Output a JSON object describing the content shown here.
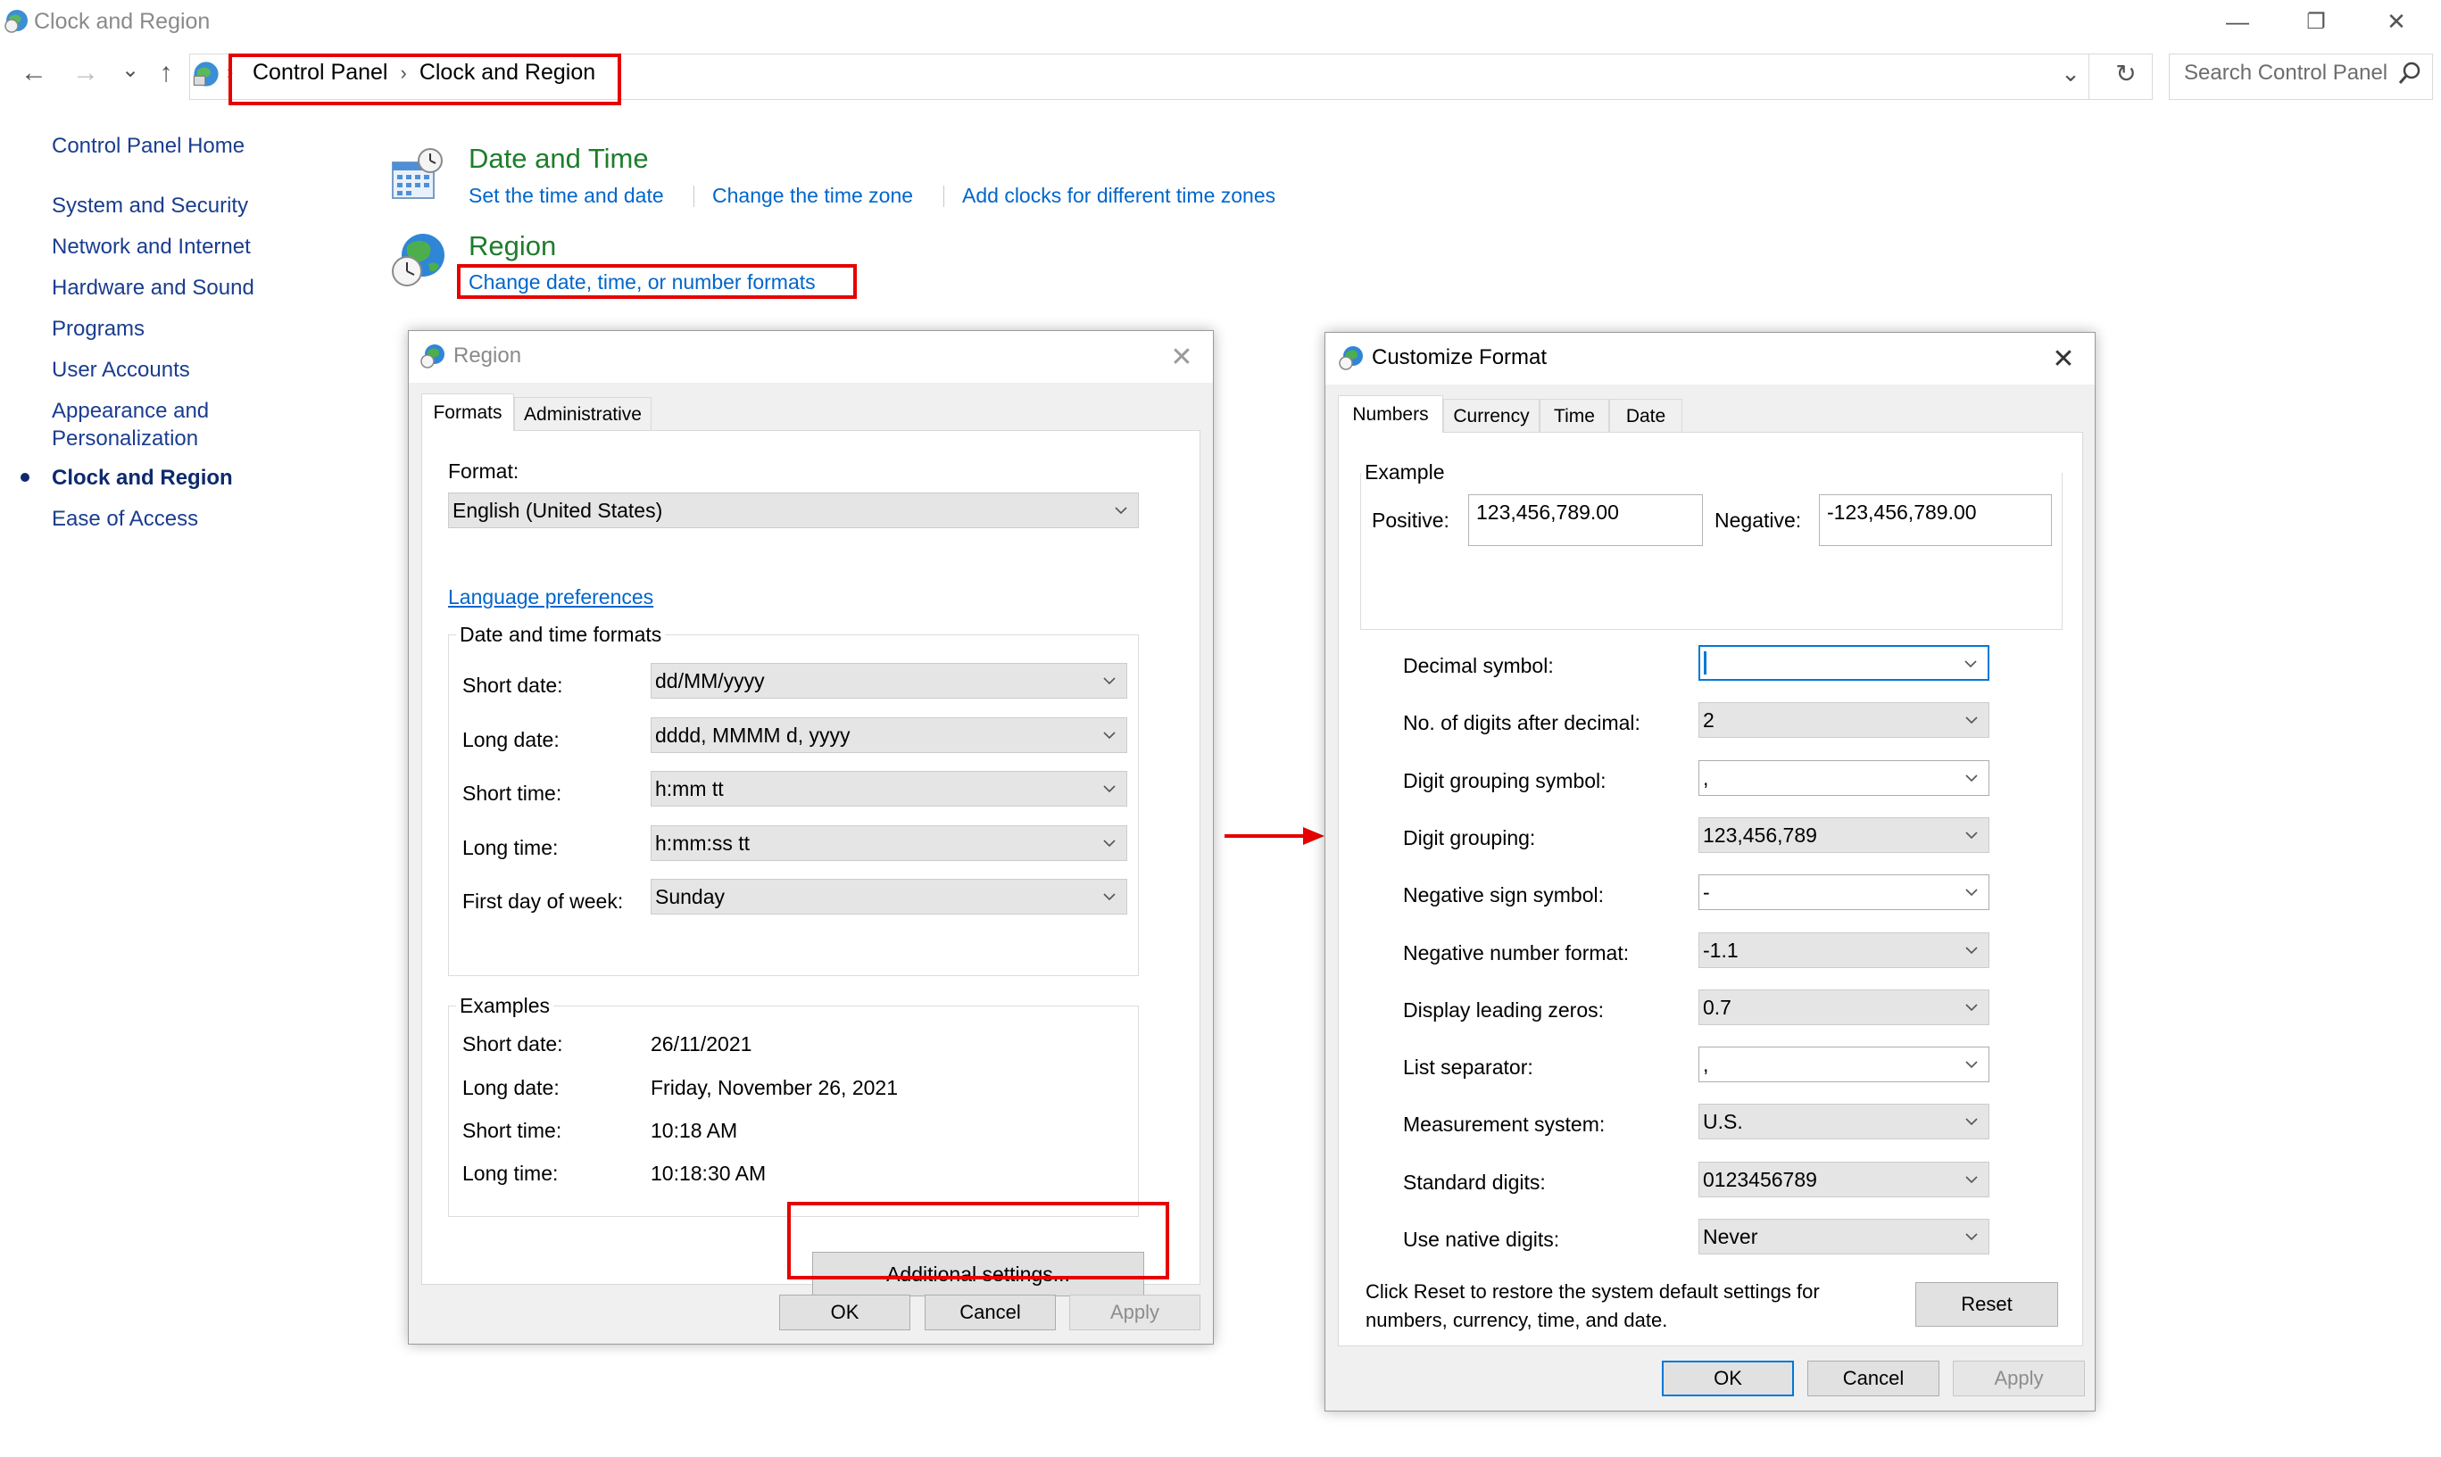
{
  "window": {
    "title": "Clock and Region",
    "minimize_glyph": "—",
    "maximize_glyph": "❐",
    "close_glyph": "✕"
  },
  "address_bar": {
    "back_glyph": "←",
    "forward_glyph": "→",
    "recent_glyph": "⌄",
    "up_glyph": "↑",
    "breadcrumb": [
      "Control Panel",
      "Clock and Region"
    ],
    "separator_glyph": "›",
    "dropdown_glyph": "⌄",
    "refresh_glyph": "↻",
    "search_placeholder": "Search Control Panel"
  },
  "sidebar": {
    "items": [
      {
        "label": "Control Panel Home"
      },
      {
        "label": "System and Security"
      },
      {
        "label": "Network and Internet"
      },
      {
        "label": "Hardware and Sound"
      },
      {
        "label": "Programs"
      },
      {
        "label": "User Accounts"
      },
      {
        "label": "Appearance and\nPersonalization"
      },
      {
        "label": "Clock and Region",
        "active": true
      },
      {
        "label": "Ease of Access"
      }
    ]
  },
  "content": {
    "date_time": {
      "heading": "Date and Time",
      "links": [
        "Set the time and date",
        "Change the time zone",
        "Add clocks for different time zones"
      ]
    },
    "region": {
      "heading": "Region",
      "link": "Change date, time, or number formats"
    }
  },
  "region_dialog": {
    "title": "Region",
    "close_glyph": "✕",
    "tabs": [
      "Formats",
      "Administrative"
    ],
    "format_label": "Format:",
    "format_value": "English (United States)",
    "language_link": "Language preferences",
    "date_time_group": "Date and time formats",
    "fields": [
      {
        "label": "Short date:",
        "value": "dd/MM/yyyy"
      },
      {
        "label": "Long date:",
        "value": "dddd, MMMM d, yyyy"
      },
      {
        "label": "Short time:",
        "value": "h:mm tt"
      },
      {
        "label": "Long time:",
        "value": "h:mm:ss tt"
      },
      {
        "label": "First day of week:",
        "value": "Sunday"
      }
    ],
    "examples_group": "Examples",
    "examples": [
      {
        "label": "Short date:",
        "value": "26/11/2021"
      },
      {
        "label": "Long date:",
        "value": "Friday, November 26, 2021"
      },
      {
        "label": "Short time:",
        "value": "10:18 AM"
      },
      {
        "label": "Long time:",
        "value": "10:18:30 AM"
      }
    ],
    "additional_button": "Additional settings...",
    "ok": "OK",
    "cancel": "Cancel",
    "apply": "Apply"
  },
  "customize_dialog": {
    "title": "Customize Format",
    "close_glyph": "✕",
    "tabs": [
      "Numbers",
      "Currency",
      "Time",
      "Date"
    ],
    "example_label": "Example",
    "positive_label": "Positive:",
    "positive_value": "123,456,789.00",
    "negative_label": "Negative:",
    "negative_value": "-123,456,789.00",
    "fields": [
      {
        "label": "Decimal symbol:",
        "value": ""
      },
      {
        "label": "No. of digits after decimal:",
        "value": "2"
      },
      {
        "label": "Digit grouping symbol:",
        "value": ","
      },
      {
        "label": "Digit grouping:",
        "value": "123,456,789"
      },
      {
        "label": "Negative sign symbol:",
        "value": "-"
      },
      {
        "label": "Negative number format:",
        "value": "-1.1"
      },
      {
        "label": "Display leading zeros:",
        "value": "0.7"
      },
      {
        "label": "List separator:",
        "value": ","
      },
      {
        "label": "Measurement system:",
        "value": "U.S."
      },
      {
        "label": "Standard digits:",
        "value": "0123456789"
      },
      {
        "label": "Use native digits:",
        "value": "Never"
      }
    ],
    "reset_text": "Click Reset to restore the system default settings for numbers, currency, time, and date.",
    "reset_button": "Reset",
    "ok": "OK",
    "cancel": "Cancel",
    "apply": "Apply"
  },
  "annotation": {
    "highlight_color": "#e60000"
  }
}
